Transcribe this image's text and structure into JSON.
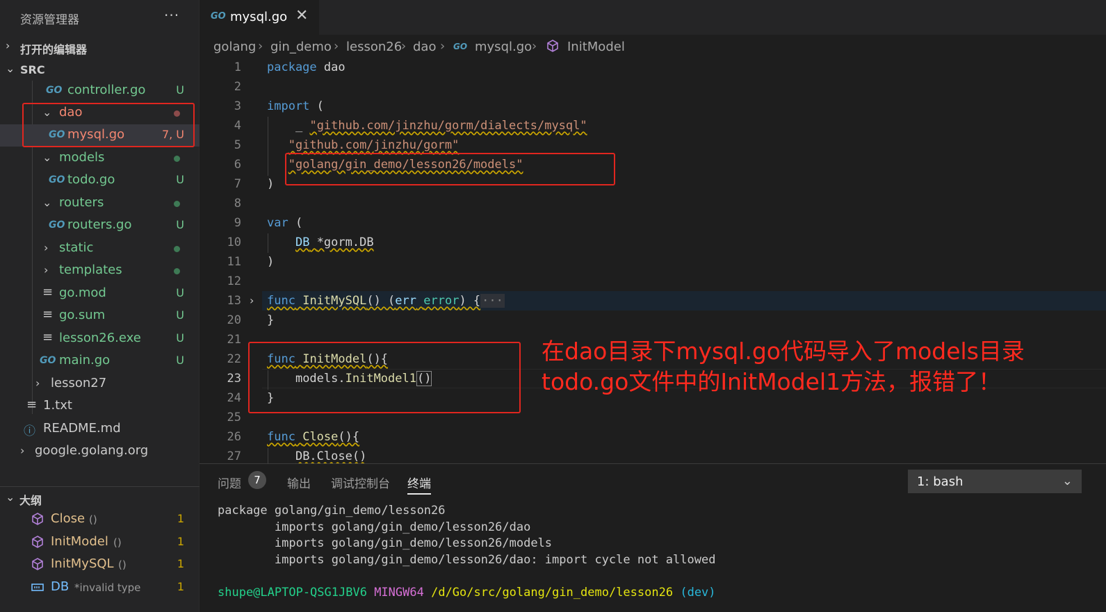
{
  "sidebar": {
    "title": "资源管理器",
    "more": "···",
    "open_editors": "打开的编辑器",
    "root": "SRC",
    "tree": [
      {
        "name": "controller.go",
        "badge": "U",
        "type": "go"
      },
      {
        "name": "dao",
        "type": "folder-open"
      },
      {
        "name": "mysql.go",
        "badge": "7, U",
        "type": "go"
      },
      {
        "name": "models",
        "type": "folder-open"
      },
      {
        "name": "todo.go",
        "badge": "U",
        "type": "go"
      },
      {
        "name": "routers",
        "type": "folder-open"
      },
      {
        "name": "routers.go",
        "badge": "U",
        "type": "go"
      },
      {
        "name": "static",
        "type": "folder-closed"
      },
      {
        "name": "templates",
        "type": "folder-closed"
      },
      {
        "name": "go.mod",
        "badge": "U",
        "type": "file"
      },
      {
        "name": "go.sum",
        "badge": "U",
        "type": "file"
      },
      {
        "name": "lesson26.exe",
        "badge": "U",
        "type": "file"
      },
      {
        "name": "main.go",
        "badge": "U",
        "type": "go"
      },
      {
        "name": "lesson27",
        "type": "folder-closed"
      },
      {
        "name": "1.txt",
        "type": "file"
      },
      {
        "name": "README.md",
        "type": "info"
      },
      {
        "name": "google.golang.org",
        "type": "folder-closed"
      }
    ],
    "outline": {
      "title": "大纲",
      "items": [
        {
          "name": "Close",
          "detail": "()",
          "count": "1",
          "kind": "method"
        },
        {
          "name": "InitModel",
          "detail": "()",
          "count": "1",
          "kind": "method"
        },
        {
          "name": "InitMySQL",
          "detail": "()",
          "count": "1",
          "kind": "method"
        },
        {
          "name": "DB",
          "detail": "*invalid type",
          "count": "1",
          "kind": "variable"
        }
      ]
    }
  },
  "editor": {
    "tab": {
      "icon": "GO",
      "label": "mysql.go",
      "close": "✕"
    },
    "breadcrumb": [
      "golang",
      "gin_demo",
      "lesson26",
      "dao",
      "mysql.go",
      "InitModel"
    ],
    "line_numbers": [
      "1",
      "2",
      "3",
      "4",
      "5",
      "6",
      "7",
      "8",
      "9",
      "10",
      "11",
      "12",
      "13",
      "20",
      "21",
      "22",
      "23",
      "24",
      "25",
      "26",
      "27"
    ],
    "code": {
      "pkg_kw": "package",
      "pkg_name": "dao",
      "import_kw": "import",
      "open_paren": "(",
      "imp1_blank": "_",
      "imp1": "\"github.com/jinzhu/gorm/dialects/mysql\"",
      "imp2": "\"github.com/jinzhu/gorm\"",
      "imp3": "\"golang/gin_demo/lesson26/models\"",
      "close_paren": ")",
      "var_kw": "var",
      "db_name": "DB",
      "db_type": "*gorm.DB",
      "func_kw": "func",
      "initmysql": "InitMySQL",
      "initmysql_sig": "() (err error) {",
      "initmysql_ret_err": "err",
      "initmysql_ret_type": "error",
      "fold_ellipsis": "···",
      "close_brace": "}",
      "initmodel": "InitModel",
      "initmodel_sig": "(){",
      "models_pkg": "models",
      "call_fn": "InitModel1",
      "call_parens": "()",
      "close_fn": "Close",
      "close_sig": "(){",
      "db_close": "DB.Close()"
    },
    "annotation": {
      "line1": "在dao目录下mysql.go代码导入了models目录",
      "line2": "todo.go文件中的InitModel1方法，报错了！"
    }
  },
  "panel": {
    "tabs": [
      "问题",
      "输出",
      "调试控制台",
      "终端"
    ],
    "problems_count": "7",
    "terminal_select": "1: bash",
    "terminal": {
      "lines": [
        "package golang/gin_demo/lesson26",
        "        imports golang/gin_demo/lesson26/dao",
        "        imports golang/gin_demo/lesson26/models",
        "        imports golang/gin_demo/lesson26/dao: import cycle not allowed"
      ],
      "prompt_user": "shupe@LAPTOP-QSG1JBV6",
      "prompt_env": "MINGW64",
      "prompt_path": "/d/Go/src/golang/gin_demo/lesson26",
      "prompt_branch": "(dev)"
    }
  },
  "colors": {
    "git_untracked": "#73c991",
    "git_error": "#f48771",
    "annotation_red": "#ff2a1f"
  }
}
